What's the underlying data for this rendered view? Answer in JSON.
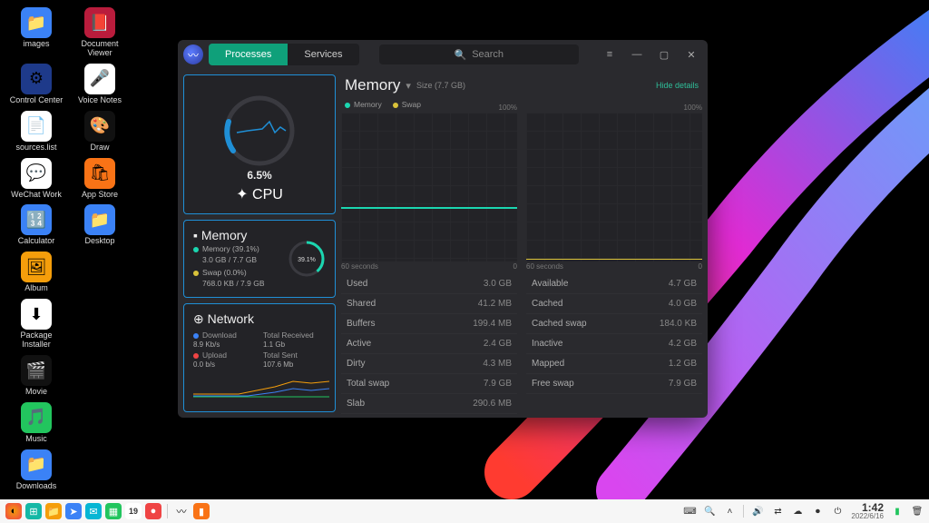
{
  "desktop": {
    "icons": [
      {
        "label": "images",
        "color": "#3b82f6",
        "glyph": "📁"
      },
      {
        "label": "Document Viewer",
        "color": "#b91c3c",
        "glyph": "📕"
      },
      {
        "label": "Control Center",
        "color": "#1e3a8a",
        "glyph": "⚙"
      },
      {
        "label": "Voice Notes",
        "color": "#ffffff",
        "glyph": "🎤"
      },
      {
        "label": "sources.list",
        "color": "#ffffff",
        "glyph": "📄"
      },
      {
        "label": "Draw",
        "color": "#111111",
        "glyph": "🎨"
      },
      {
        "label": "WeChat Work",
        "color": "#ffffff",
        "glyph": "💬"
      },
      {
        "label": "App Store",
        "color": "#f97316",
        "glyph": "🛍"
      },
      {
        "label": "Calculator",
        "color": "#3b82f6",
        "glyph": "🔢"
      },
      {
        "label": "Desktop",
        "color": "#3b82f6",
        "glyph": "📁"
      },
      {
        "label": "Album",
        "color": "#f59e0b",
        "glyph": "🖼"
      },
      {
        "label": "",
        "color": "transparent",
        "glyph": ""
      },
      {
        "label": "Package Installer",
        "color": "#ffffff",
        "glyph": "⬇"
      },
      {
        "label": "",
        "color": "transparent",
        "glyph": ""
      },
      {
        "label": "Movie",
        "color": "#111111",
        "glyph": "🎬"
      },
      {
        "label": "",
        "color": "transparent",
        "glyph": ""
      },
      {
        "label": "Music",
        "color": "#22c55e",
        "glyph": "🎵"
      },
      {
        "label": "",
        "color": "transparent",
        "glyph": ""
      },
      {
        "label": "Downloads",
        "color": "#3b82f6",
        "glyph": "📁"
      }
    ]
  },
  "window": {
    "tabs": {
      "processes": "Processes",
      "services": "Services"
    },
    "search_placeholder": "Search",
    "left": {
      "cpu": {
        "pct": "6.5%",
        "label": "CPU"
      },
      "memory": {
        "title": "Memory",
        "mem_label": "Memory (39.1%)",
        "mem_detail": "3.0 GB / 7.7 GB",
        "swap_label": "Swap (0.0%)",
        "swap_detail": "768.0 KB / 7.9 GB",
        "donut_pct": "39.1%"
      },
      "network": {
        "title": "Network",
        "download_label": "Download",
        "download_val": "8.9 Kb/s",
        "total_recv_label": "Total Received",
        "total_recv_val": "1.1 Gb",
        "upload_label": "Upload",
        "upload_val": "0.0 b/s",
        "total_sent_label": "Total Sent",
        "total_sent_val": "107.6 Mb"
      }
    },
    "right": {
      "title": "Memory",
      "size": "Size (7.7 GB)",
      "hide": "Hide details",
      "legend_mem": "Memory",
      "legend_swap": "Swap",
      "axis_100": "100%",
      "axis_60": "60 seconds",
      "axis_0": "0",
      "rowsL": [
        {
          "k": "Used",
          "v": "3.0 GB"
        },
        {
          "k": "Shared",
          "v": "41.2 MB"
        },
        {
          "k": "Buffers",
          "v": "199.4 MB"
        },
        {
          "k": "Active",
          "v": "2.4 GB"
        },
        {
          "k": "Dirty",
          "v": "4.3 MB"
        },
        {
          "k": "Total swap",
          "v": "7.9 GB"
        },
        {
          "k": "Slab",
          "v": "290.6 MB"
        }
      ],
      "rowsR": [
        {
          "k": "Available",
          "v": "4.7 GB"
        },
        {
          "k": "Cached",
          "v": "4.0 GB"
        },
        {
          "k": "Cached swap",
          "v": "184.0 KB"
        },
        {
          "k": "Inactive",
          "v": "4.2 GB"
        },
        {
          "k": "Mapped",
          "v": "1.2 GB"
        },
        {
          "k": "Free swap",
          "v": "7.9 GB"
        }
      ]
    }
  },
  "taskbar": {
    "date_badge": "19",
    "time": "1:42",
    "date": "2022/6/16"
  },
  "chart_data": {
    "type": "line",
    "title": "Memory",
    "series": [
      {
        "name": "Memory",
        "color": "#1bd6b0",
        "values": [
          39,
          39,
          39,
          39,
          39,
          39,
          39,
          39,
          39,
          39
        ]
      },
      {
        "name": "Swap",
        "color": "#d9c23a",
        "values": [
          0,
          0,
          0,
          0,
          0,
          0,
          0,
          0,
          0,
          0
        ]
      }
    ],
    "x": [
      "60s",
      "",
      "",
      "",
      "",
      "",
      "",
      "",
      "",
      "0"
    ],
    "ylim": [
      0,
      100
    ],
    "ylabel": "%"
  }
}
